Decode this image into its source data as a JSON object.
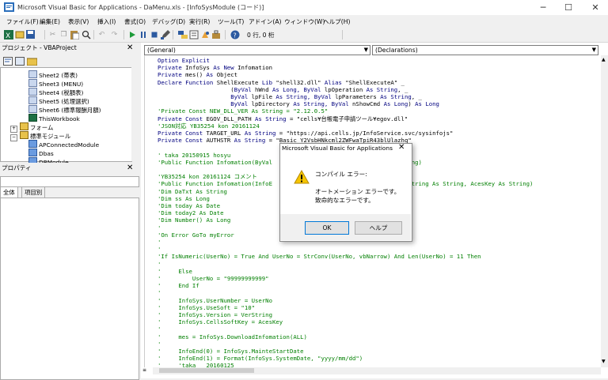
{
  "window": {
    "title": "Microsoft Visual Basic for Applications - DaMenu.xls - [InfoSysModule (コード)]",
    "minimize": "─",
    "maximize": "☐",
    "close": "✕"
  },
  "menu": [
    {
      "label": "ファイル(F)"
    },
    {
      "label": "編集(E)"
    },
    {
      "label": "表示(V)"
    },
    {
      "label": "挿入(I)"
    },
    {
      "label": "書式(O)"
    },
    {
      "label": "デバッグ(D)"
    },
    {
      "label": "実行(R)"
    },
    {
      "label": "ツール(T)"
    },
    {
      "label": "アドイン(A)"
    },
    {
      "label": "ウィンドウ(W)"
    },
    {
      "label": "ヘルプ(H)"
    }
  ],
  "toolbar": {
    "cursor_position": "0 行, 0 桁",
    "icons": [
      "excel-icon",
      "insert-module-icon",
      "save-icon",
      "cut-icon",
      "copy-icon",
      "paste-icon",
      "find-icon",
      "undo-icon",
      "redo-icon",
      "run-icon",
      "break-icon",
      "reset-icon",
      "design-mode-icon",
      "project-explorer-icon",
      "properties-icon",
      "object-browser-icon",
      "toolbox-icon",
      "help-icon"
    ]
  },
  "project_pane": {
    "title": "プロジェクト - VBAProject",
    "close": "✕",
    "tree": [
      {
        "label": "Sheet2 (帯表)",
        "kind": "sheet"
      },
      {
        "label": "Sheet3 (MENU)",
        "kind": "sheet"
      },
      {
        "label": "Sheet4 (税額表)",
        "kind": "sheet"
      },
      {
        "label": "Sheet5 (処理選択)",
        "kind": "sheet"
      },
      {
        "label": "Sheet6 (標準報酬月額)",
        "kind": "sheet"
      },
      {
        "label": "ThisWorkbook",
        "kind": "sheet"
      },
      {
        "label": "フォーム",
        "kind": "folder",
        "toggle": "+"
      },
      {
        "label": "標準モジュール",
        "kind": "folder",
        "toggle": "−"
      },
      {
        "label": "APConnectedModule",
        "kind": "module"
      },
      {
        "label": "Dbas",
        "kind": "module"
      },
      {
        "label": "DBModule",
        "kind": "module"
      }
    ]
  },
  "properties_pane": {
    "title": "プロパティ",
    "close": "✕",
    "tabs": [
      "全体",
      "項目別"
    ]
  },
  "code_window": {
    "object_combo": "(General)",
    "procedure_combo": "(Declarations)",
    "lines": [
      [
        {
          "t": "Option Explicit",
          "c": "kw"
        }
      ],
      [
        {
          "t": "Private ",
          "c": "kw"
        },
        {
          "t": "InfoSys ",
          "c": ""
        },
        {
          "t": "As New ",
          "c": "kw"
        },
        {
          "t": "Infomation",
          "c": ""
        }
      ],
      [
        {
          "t": "Private ",
          "c": "kw"
        },
        {
          "t": "mes() ",
          "c": ""
        },
        {
          "t": "As ",
          "c": "kw"
        },
        {
          "t": "Object",
          "c": ""
        }
      ],
      [
        {
          "t": "Declare Function ",
          "c": "kw"
        },
        {
          "t": "ShellExecute ",
          "c": ""
        },
        {
          "t": "Lib ",
          "c": "kw"
        },
        {
          "t": "\"shell32.dll\" ",
          "c": ""
        },
        {
          "t": "Alias ",
          "c": "kw"
        },
        {
          "t": "\"ShellExecuteA\" _",
          "c": ""
        }
      ],
      [
        {
          "t": "                     (",
          "c": ""
        },
        {
          "t": "ByVal ",
          "c": "kw"
        },
        {
          "t": "hWnd ",
          "c": ""
        },
        {
          "t": "As Long, ByVal ",
          "c": "kw"
        },
        {
          "t": "lpOperation ",
          "c": ""
        },
        {
          "t": "As String",
          "c": "kw"
        },
        {
          "t": ", _",
          "c": ""
        }
      ],
      [
        {
          "t": "                     ",
          "c": ""
        },
        {
          "t": "ByVal ",
          "c": "kw"
        },
        {
          "t": "lpFile ",
          "c": ""
        },
        {
          "t": "As String, ByVal ",
          "c": "kw"
        },
        {
          "t": "lpParameters ",
          "c": ""
        },
        {
          "t": "As String",
          "c": "kw"
        },
        {
          "t": ", _",
          "c": ""
        }
      ],
      [
        {
          "t": "                     ",
          "c": ""
        },
        {
          "t": "ByVal ",
          "c": "kw"
        },
        {
          "t": "lpDirectory ",
          "c": ""
        },
        {
          "t": "As String, ByVal ",
          "c": "kw"
        },
        {
          "t": "nShowCmd ",
          "c": ""
        },
        {
          "t": "As Long",
          "c": "kw"
        },
        {
          "t": ") ",
          "c": ""
        },
        {
          "t": "As Long",
          "c": "kw"
        }
      ],
      [
        {
          "t": "'Private Const NEW_DLL_VER As String = \"2.12.0.5\"",
          "c": "cm"
        }
      ],
      [
        {
          "t": "Private Const ",
          "c": "kw"
        },
        {
          "t": "EGOV_DLL_PATH ",
          "c": ""
        },
        {
          "t": "As String ",
          "c": "kw"
        },
        {
          "t": "= \"cells¥台帳電子申請ツール¥egov.dll\"",
          "c": ""
        }
      ],
      [
        {
          "t": "'JSON対応 YB35254 kon 20161124",
          "c": "cm"
        }
      ],
      [
        {
          "t": "Private Const ",
          "c": "kw"
        },
        {
          "t": "TARGET_URL ",
          "c": ""
        },
        {
          "t": "As String ",
          "c": "kw"
        },
        {
          "t": "= \"https://api.cells.jp/InfoService.svc/sysinfojs\"",
          "c": ""
        }
      ],
      [
        {
          "t": "Private Const ",
          "c": "kw"
        },
        {
          "t": "AUTHSTR ",
          "c": ""
        },
        {
          "t": "As String ",
          "c": "kw"
        },
        {
          "t": "= \"Basic Y2VsbHNkcml2ZWFwaTpiR43blUlazhq\"",
          "c": ""
        }
      ],
      [
        {
          "t": "",
          "c": ""
        }
      ],
      [
        {
          "t": "' taka 20150915 hosyu",
          "c": "cm"
        }
      ],
      [
        {
          "t": "'Public Function Infomation(ByVal                                        ng)",
          "c": "cm"
        }
      ],
      [
        {
          "t": "",
          "c": ""
        }
      ],
      [
        {
          "t": "'YB35254 kon 20161124 コメント",
          "c": "cm"
        }
      ],
      [
        {
          "t": "'Public Function Infomation(InfoE                                ng, VerString As String, AcesKey As String)",
          "c": "cm"
        }
      ],
      [
        {
          "t": "'Dim DaTxt As String",
          "c": "cm"
        }
      ],
      [
        {
          "t": "'Dim ss As Long",
          "c": "cm"
        }
      ],
      [
        {
          "t": "'Dim today As Date",
          "c": "cm"
        }
      ],
      [
        {
          "t": "'Dim today2 As Date",
          "c": "cm"
        }
      ],
      [
        {
          "t": "'Dim Number() As Long",
          "c": "cm"
        }
      ],
      [
        {
          "t": "'",
          "c": "cm"
        }
      ],
      [
        {
          "t": "'On Error GoTo myError",
          "c": "cm"
        }
      ],
      [
        {
          "t": "'",
          "c": "cm"
        }
      ],
      [
        {
          "t": "'",
          "c": "cm"
        }
      ],
      [
        {
          "t": "'If IsNumeric(UserNo) = True And UserNo = StrConv(UserNo, vbNarrow) And Len(UserNo) = 11 Then",
          "c": "cm"
        }
      ],
      [
        {
          "t": "'",
          "c": "cm"
        }
      ],
      [
        {
          "t": "'     Else",
          "c": "cm"
        }
      ],
      [
        {
          "t": "'         UserNo = \"99999999999\"",
          "c": "cm"
        }
      ],
      [
        {
          "t": "'     End If",
          "c": "cm"
        }
      ],
      [
        {
          "t": "'",
          "c": "cm"
        }
      ],
      [
        {
          "t": "'     InfoSys.UserNumber = UserNo",
          "c": "cm"
        }
      ],
      [
        {
          "t": "'     InfoSys.UseSoft = \"10\"",
          "c": "cm"
        }
      ],
      [
        {
          "t": "'     InfoSys.Version = VerString",
          "c": "cm"
        }
      ],
      [
        {
          "t": "'     InfoSys.CellsSoftKey = AcesKey",
          "c": "cm"
        }
      ],
      [
        {
          "t": "'",
          "c": "cm"
        }
      ],
      [
        {
          "t": "'     mes = InfoSys.DownloadInfomation(ALL)",
          "c": "cm"
        }
      ],
      [
        {
          "t": "'",
          "c": "cm"
        }
      ],
      [
        {
          "t": "'     InfoEnd(0) = InfoSys.MainteStartDate",
          "c": "cm"
        }
      ],
      [
        {
          "t": "'     InfoEnd(1) = Format(InfoSys.SystemDate, \"yyyy/mm/dd\")",
          "c": "cm"
        }
      ],
      [
        {
          "t": "'     'taka   20160125",
          "c": "cm"
        }
      ]
    ]
  },
  "dialog": {
    "title": "Microsoft Visual Basic for Applications",
    "close": "✕",
    "heading": "コンパイル エラー:",
    "message_line1": "オートメーション エラーです。",
    "message_line2": "致命的なエラーです。",
    "ok_label": "OK",
    "help_label": "ヘルプ",
    "icon": "warning-icon"
  },
  "colors": {
    "keyword": "#00007f",
    "comment": "#007f00",
    "warning": "#f5c400"
  }
}
